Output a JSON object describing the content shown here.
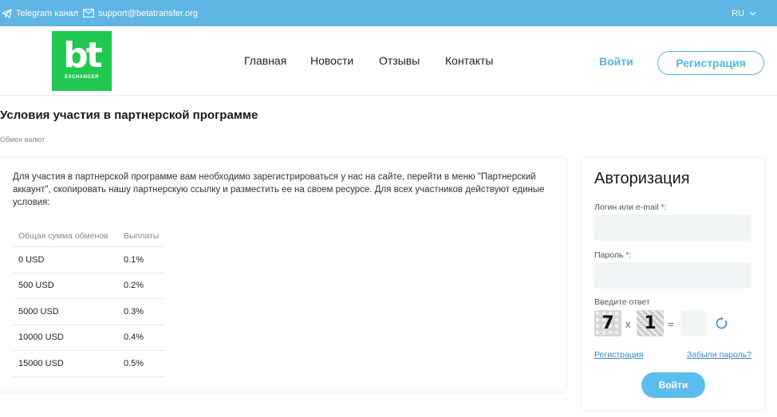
{
  "topbar": {
    "telegram": "Telegram канал",
    "email": "support@betatransfer.org",
    "lang": "RU"
  },
  "header": {
    "logo_text": "bt",
    "logo_sub": "EXCHANGER",
    "nav": [
      "Главная",
      "Новости",
      "Отзывы",
      "Контакты"
    ],
    "login": "Войти",
    "register": "Регистрация"
  },
  "page": {
    "title": "Условия участия в партнерской программе",
    "breadcrumb": "Обмен валют"
  },
  "content": {
    "intro": "Для участия в партнерской программе вам необходимо зарегистрироваться у нас на сайте, перейти в меню \"Партнерский аккаунт\", скопировать нашу партнерскую ссылку и разместить ее на своем ресурсе. Для всех участников действуют единые условия:",
    "table": {
      "headers": [
        "Общая сумма обменов",
        "Выплаты"
      ],
      "rows": [
        [
          "0 USD",
          "0.1%"
        ],
        [
          "500 USD",
          "0.2%"
        ],
        [
          "5000 USD",
          "0.3%"
        ],
        [
          "10000 USD",
          "0.4%"
        ],
        [
          "15000 USD",
          "0.5%"
        ]
      ]
    }
  },
  "auth": {
    "title": "Авторизация",
    "login_label": "Логин или e-mail",
    "password_label": "Пароль",
    "required_mark": "*",
    "label_suffix": ":",
    "captcha_label": "Введите ответ",
    "captcha_a": "7",
    "captcha_op": "x",
    "captcha_b": "1",
    "captcha_eq": "=",
    "register_link": "Регистрация",
    "forgot_link": "Забыли пароль?",
    "submit": "Войти"
  },
  "colors": {
    "topbar": "#5fb6e4",
    "accent": "#55b5e6",
    "logo": "#20c850"
  }
}
